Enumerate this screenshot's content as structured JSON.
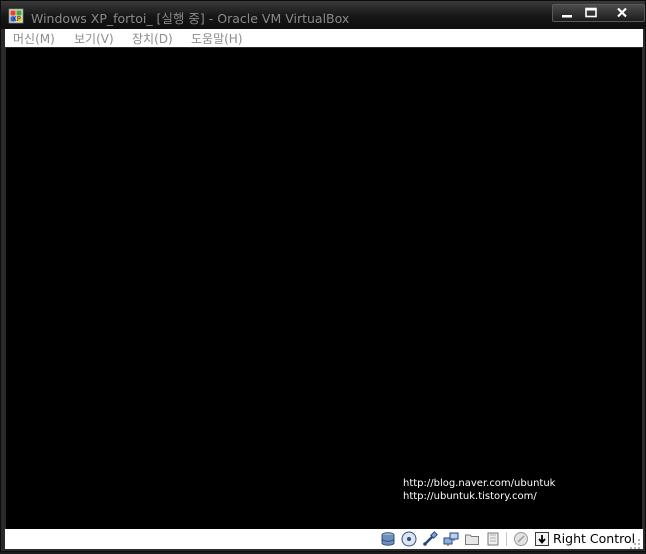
{
  "window": {
    "title": "Windows XP_fortoi_ [실행 중] - Oracle VM VirtualBox"
  },
  "menu": [
    {
      "label": "머신(M)"
    },
    {
      "label": "보기(V)"
    },
    {
      "label": "장치(D)"
    },
    {
      "label": "도움말(H)"
    }
  ],
  "screen": {
    "watermark_lines": [
      "http://blog.naver.com/ubuntuk",
      "http://ubuntuk.tistory.com/"
    ]
  },
  "statusbar": {
    "icons": [
      "hard-disk-icon",
      "cd-dvd-icon",
      "usb-icon",
      "network-icon",
      "shared-folder-icon",
      "video-capture-icon",
      "mouse-integration-icon",
      "host-key-icon"
    ],
    "host_key": "Right Control"
  },
  "colors": {
    "titlebar": "#161616",
    "screen": "#000000",
    "menubar": "#ffffff"
  }
}
